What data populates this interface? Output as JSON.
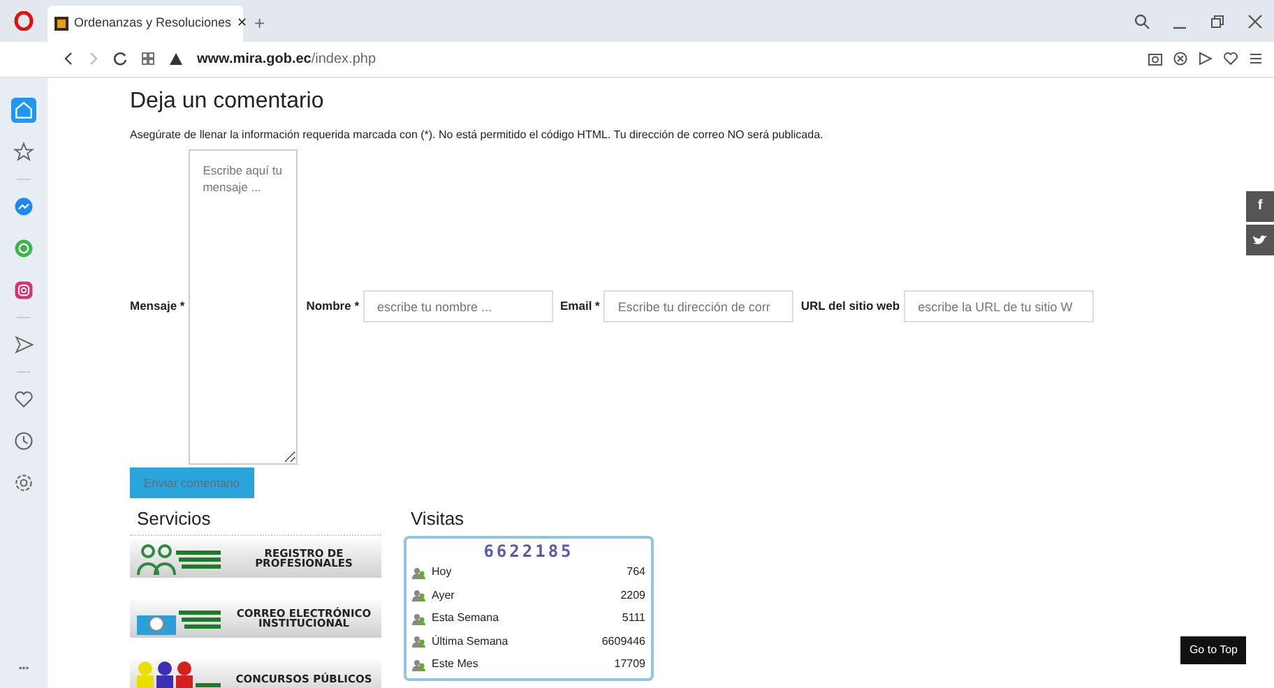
{
  "browser": {
    "tab": {
      "title": "Ordenanzas y Resoluciones",
      "close": "✕",
      "new_tab": "+"
    },
    "url_host": "www.mira.gob.ec",
    "url_path": "/index.php"
  },
  "sidebar": [
    {
      "kind": "home",
      "selected": true
    },
    {
      "kind": "star",
      "selected": false
    },
    {
      "kind": "separator"
    },
    {
      "kind": "messenger",
      "selected": false
    },
    {
      "kind": "whatsapp",
      "selected": false
    },
    {
      "kind": "instagram",
      "selected": false
    },
    {
      "kind": "separator"
    },
    {
      "kind": "send",
      "selected": false
    },
    {
      "kind": "separator"
    },
    {
      "kind": "heart",
      "selected": false
    },
    {
      "kind": "clock",
      "selected": false
    },
    {
      "kind": "gear",
      "selected": false
    }
  ],
  "sidebar_more": "•••",
  "comment": {
    "title": "Deja un comentario",
    "notice": "Asegúrate de llenar la información requerida marcada con (*). No está permitido el código HTML. Tu dirección de correo NO será publicada.",
    "fields": [
      {
        "label": "Mensaje *",
        "kind": "textarea",
        "placeholder": "Escribe aquí tu mensaje ..."
      },
      {
        "label": "Nombre *",
        "kind": "input",
        "placeholder": "escribe tu nombre ..."
      },
      {
        "label": "Email *",
        "kind": "input",
        "placeholder": "Escribe tu dirección de corr"
      },
      {
        "label": "URL del sitio web",
        "kind": "input",
        "placeholder": "escribe la URL de tu sitio W"
      }
    ],
    "submit": "Enviar comentario"
  },
  "servicios": {
    "title": "Servicios",
    "banners": [
      {
        "kind": "people",
        "lines": [
          "REGISTRO DE",
          "PROFESIONALES"
        ]
      },
      {
        "kind": "mail",
        "lines": [
          "CORREO ELECTRÓNICO",
          "INSTITUCIONAL"
        ]
      },
      {
        "kind": "group",
        "lines": [
          "CONCURSOS PÚBLICOS"
        ]
      }
    ]
  },
  "visitas": {
    "title": "Visitas",
    "counter": "6622185",
    "rows": [
      {
        "label": "Hoy",
        "value": "764"
      },
      {
        "label": "Ayer",
        "value": "2209"
      },
      {
        "label": "Esta Semana",
        "value": "5111"
      },
      {
        "label": "Última Semana",
        "value": "6609446"
      },
      {
        "label": "Este Mes",
        "value": "17709"
      }
    ]
  },
  "social": [
    {
      "kind": "facebook",
      "text": "f"
    },
    {
      "kind": "twitter"
    }
  ],
  "go_top": "Go to Top"
}
